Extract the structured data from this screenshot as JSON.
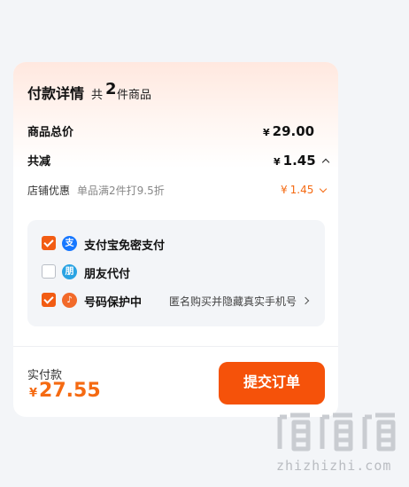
{
  "order": {
    "title": "付款详情",
    "count_prefix": "共",
    "count_num": "2",
    "count_suffix": "件商品"
  },
  "summary": {
    "total_label": "商品总价",
    "total_currency": "¥",
    "total_value": "29.00",
    "discount_label": "共减",
    "discount_currency": "¥",
    "discount_value": "1.45",
    "store_discount_label": "店铺优惠",
    "store_discount_desc": "单品满2件打9.5折",
    "store_discount_currency": "¥",
    "store_discount_value": "1.45"
  },
  "payment_options": [
    {
      "label": "支付宝免密支付",
      "checked": true,
      "icon": "alipay-icon",
      "icon_char": "支"
    },
    {
      "label": "朋友代付",
      "checked": false,
      "icon": "friend-pay-icon",
      "icon_char": "朋"
    },
    {
      "label": "号码保护中",
      "checked": true,
      "icon": "phone-shield-icon",
      "icon_char": "♪",
      "detail": "匿名购买并隐藏真实手机号"
    }
  ],
  "footer": {
    "paid_label": "实付款",
    "paid_currency": "¥",
    "paid_value": "27.55",
    "submit_label": "提交订单"
  },
  "watermark": {
    "text": "zhizhizhi.com"
  },
  "colors": {
    "accent": "#f5520a",
    "price_orange": "#f56a12",
    "alipay_blue": "#1677ff",
    "friend_blue": "#29a3e3",
    "shield_orange": "#f26a2a"
  }
}
